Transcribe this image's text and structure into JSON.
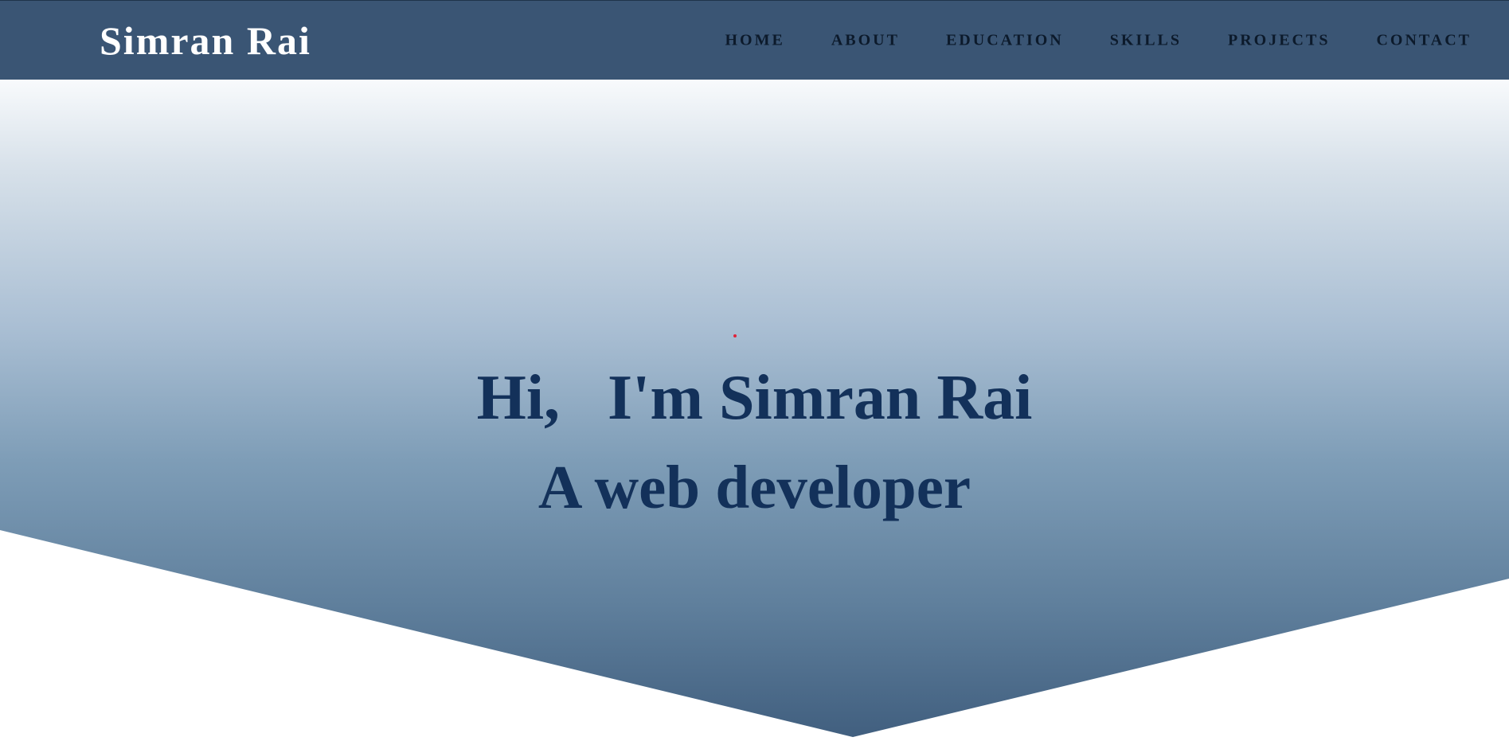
{
  "header": {
    "brand": "Simran Rai",
    "nav": [
      {
        "label": "HOME"
      },
      {
        "label": "ABOUT"
      },
      {
        "label": "EDUCATION"
      },
      {
        "label": "SKILLS"
      },
      {
        "label": "PROJECTS"
      },
      {
        "label": "CONTACT"
      }
    ]
  },
  "hero": {
    "greeting": "Hi,   I'm Simran Rai",
    "tagline": "A web developer"
  },
  "colors": {
    "navbar_bg": "#3a5574",
    "heading_text": "#13315a",
    "nav_text": "#0c1a2b",
    "brand_text": "#ffffff",
    "accent_dot": "#e0233a"
  }
}
